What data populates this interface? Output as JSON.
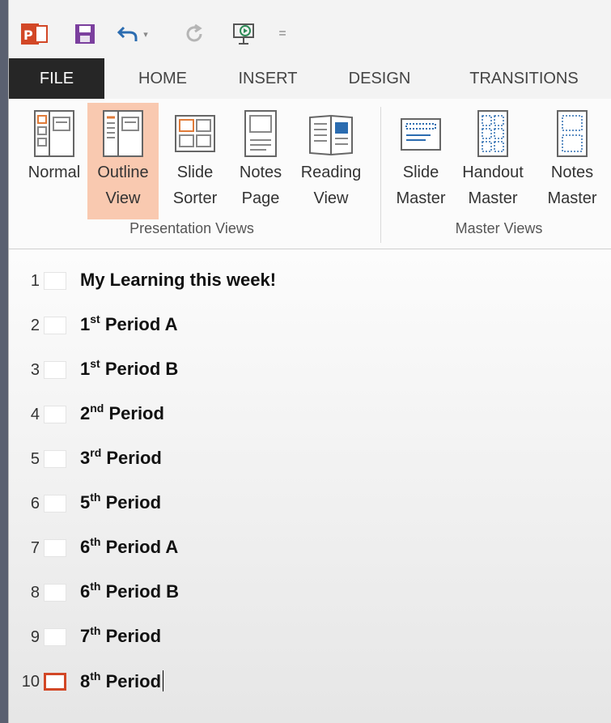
{
  "quick_access": [
    {
      "name": "powerpoint-logo-icon"
    },
    {
      "name": "save-icon"
    },
    {
      "name": "undo-icon"
    },
    {
      "name": "redo-icon"
    },
    {
      "name": "start-presentation-icon"
    },
    {
      "name": "customize-qat-icon"
    }
  ],
  "tabs": [
    "FILE",
    "HOME",
    "INSERT",
    "DESIGN",
    "TRANSITIONS"
  ],
  "ribbon": {
    "presentation_views": {
      "label": "Presentation Views",
      "buttons": [
        {
          "line1": "Normal",
          "line2": ""
        },
        {
          "line1": "Outline",
          "line2": "View"
        },
        {
          "line1": "Slide",
          "line2": "Sorter"
        },
        {
          "line1": "Notes",
          "line2": "Page"
        },
        {
          "line1": "Reading",
          "line2": "View"
        }
      ]
    },
    "master_views": {
      "label": "Master Views",
      "buttons": [
        {
          "line1": "Slide",
          "line2": "Master"
        },
        {
          "line1": "Handout",
          "line2": "Master"
        },
        {
          "line1": "Notes",
          "line2": "Master"
        }
      ]
    }
  },
  "outline": [
    {
      "num": "1",
      "pre": "My Learning this week!",
      "sup": "",
      "post": ""
    },
    {
      "num": "2",
      "pre": "1",
      "sup": "st",
      "post": " Period A"
    },
    {
      "num": "3",
      "pre": "1",
      "sup": "st",
      "post": " Period B"
    },
    {
      "num": "4",
      "pre": "2",
      "sup": "nd",
      "post": " Period"
    },
    {
      "num": "5",
      "pre": "3",
      "sup": "rd",
      "post": " Period"
    },
    {
      "num": "6",
      "pre": "5",
      "sup": "th",
      "post": " Period"
    },
    {
      "num": "7",
      "pre": "6",
      "sup": "th",
      "post": " Period A"
    },
    {
      "num": "8",
      "pre": "6",
      "sup": "th",
      "post": " Period B"
    },
    {
      "num": "9",
      "pre": "7",
      "sup": "th",
      "post": " Period"
    },
    {
      "num": "10",
      "pre": "8",
      "sup": "th",
      "post": " Period"
    }
  ],
  "selected_slide": "10",
  "colors": {
    "accent": "#d24726",
    "selected_view": "#f9c9b0",
    "file_tab": "#262626"
  }
}
